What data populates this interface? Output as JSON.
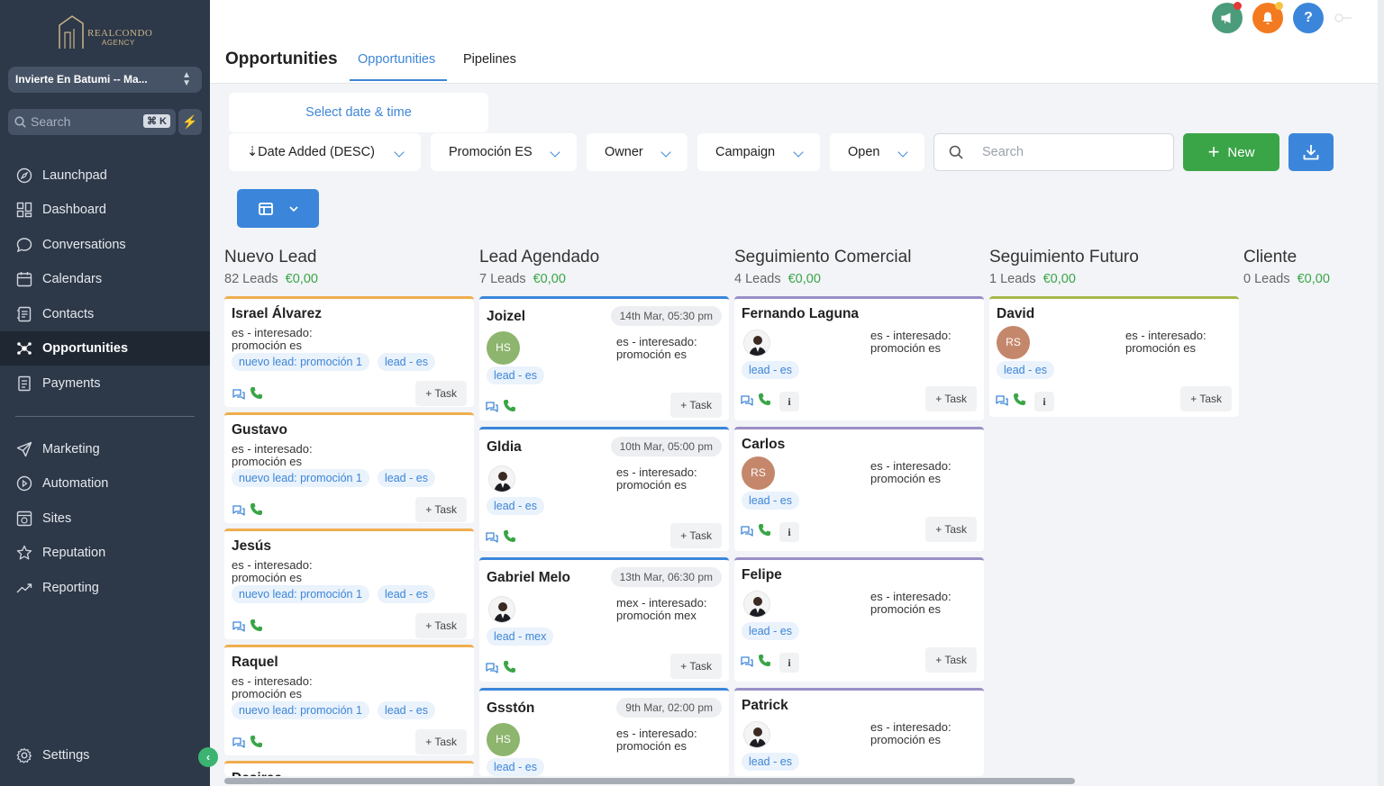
{
  "sidebar": {
    "logo_text": "REALCONDO",
    "logo_sub": "AGENCY",
    "location": "Invierte En Batumi -- Ma...",
    "search_placeholder": "Search",
    "search_shortcut": "⌘ K",
    "items": [
      {
        "label": "Launchpad",
        "icon": "rocket-icon"
      },
      {
        "label": "Dashboard",
        "icon": "grid-icon"
      },
      {
        "label": "Conversations",
        "icon": "chat-icon"
      },
      {
        "label": "Calendars",
        "icon": "calendar-icon"
      },
      {
        "label": "Contacts",
        "icon": "contacts-icon"
      },
      {
        "label": "Opportunities",
        "icon": "opportunities-icon",
        "active": true
      },
      {
        "label": "Payments",
        "icon": "payments-icon"
      },
      {
        "label": "Marketing",
        "icon": "send-icon"
      },
      {
        "label": "Automation",
        "icon": "automation-icon"
      },
      {
        "label": "Sites",
        "icon": "sites-icon"
      },
      {
        "label": "Reputation",
        "icon": "star-icon"
      },
      {
        "label": "Reporting",
        "icon": "trend-icon"
      }
    ],
    "settings": "Settings"
  },
  "header": {
    "title": "Opportunities",
    "tabs": [
      "Opportunities",
      "Pipelines"
    ],
    "active_tab": 0
  },
  "toolbar": {
    "date_select": "Select date & time",
    "filters": [
      "⇣Date Added (DESC)",
      "Promoción ES",
      "Owner",
      "Campaign",
      "Open"
    ],
    "search_placeholder": "Search",
    "new_label": "New"
  },
  "colors": {
    "accent": "#3d86d6",
    "green": "#3aa547",
    "sidebar": "#2d3848",
    "orange": "#f0ad4e",
    "blue": "#3b86da",
    "purple": "#9b8fc7",
    "olive": "#a6b84a"
  },
  "columns": [
    {
      "title": "Nuevo Lead",
      "count": "82 Leads",
      "amount": "€0,00",
      "color": "#f0ad4e",
      "cards": [
        {
          "name": "Israel Álvarez",
          "desc1": "es - interesado:",
          "desc2": "promoción es",
          "tags": [
            "nuevo lead: promoción 1",
            "lead - es"
          ],
          "task": "+ Task"
        },
        {
          "name": "Gustavo",
          "desc1": "es - interesado:",
          "desc2": "promoción es",
          "tags": [
            "nuevo lead: promoción 1",
            "lead - es"
          ],
          "task": "+ Task"
        },
        {
          "name": "Jesús",
          "desc1": "es - interesado:",
          "desc2": "promoción es",
          "tags": [
            "nuevo lead: promoción 1",
            "lead - es"
          ],
          "task": "+ Task"
        },
        {
          "name": "Raquel",
          "desc1": "es - interesado:",
          "desc2": "promoción es",
          "tags": [
            "nuevo lead: promoción 1",
            "lead - es"
          ],
          "task": "+ Task"
        },
        {
          "name": "Desiree"
        }
      ]
    },
    {
      "title": "Lead Agendado",
      "count": "7 Leads",
      "amount": "€0,00",
      "color": "#3b86da",
      "cards": [
        {
          "name": "Joizel",
          "date": "14th Mar, 05:30 pm",
          "avatar": "HS",
          "desc1": "es - interesado:",
          "desc2": "promoción es",
          "tags": [
            "lead - es"
          ],
          "task": "+ Task"
        },
        {
          "name": "Gldia",
          "date": "10th Mar, 05:00 pm",
          "desc1": "es - interesado:",
          "desc2": "promoción es",
          "tags": [
            "lead - es"
          ],
          "task": "+ Task"
        },
        {
          "name": "Gabriel Melo",
          "date": "13th Mar, 06:30 pm",
          "desc1": "mex - interesado:",
          "desc2": "promoción mex",
          "tags": [
            "lead - mex"
          ],
          "task": "+ Task"
        },
        {
          "name": "Gsstón",
          "date": "9th Mar, 02:00 pm",
          "avatar": "HS",
          "desc1": "es - interesado:",
          "desc2": "promoción es",
          "tags": [
            "lead - es"
          ]
        }
      ]
    },
    {
      "title": "Seguimiento Comercial",
      "count": "4 Leads",
      "amount": "€0,00",
      "color": "#9b8fc7",
      "cards": [
        {
          "name": "Fernando Laguna",
          "desc1": "es - interesado:",
          "desc2": "promoción es",
          "tags": [
            "lead - es"
          ],
          "task": "+ Task"
        },
        {
          "name": "Carlos",
          "avatar": "RS",
          "desc1": "es - interesado:",
          "desc2": "promoción es",
          "tags": [
            "lead - es"
          ],
          "task": "+ Task"
        },
        {
          "name": "Felipe",
          "desc1": "es - interesado:",
          "desc2": "promoción es",
          "tags": [
            "lead - es"
          ],
          "task": "+ Task"
        },
        {
          "name": "Patrick",
          "desc1": "es - interesado:",
          "desc2": "promoción es",
          "tags": [
            "lead - es"
          ]
        }
      ]
    },
    {
      "title": "Seguimiento Futuro",
      "count": "1 Leads",
      "amount": "€0,00",
      "color": "#a6b84a",
      "cards": [
        {
          "name": "David",
          "avatar": "RS",
          "desc1": "es - interesado:",
          "desc2": "promoción es",
          "tags": [
            "lead - es"
          ],
          "task": "+ Task"
        }
      ]
    },
    {
      "title": "Cliente",
      "count": "0 Leads",
      "amount": "€0,00",
      "cards": []
    }
  ]
}
